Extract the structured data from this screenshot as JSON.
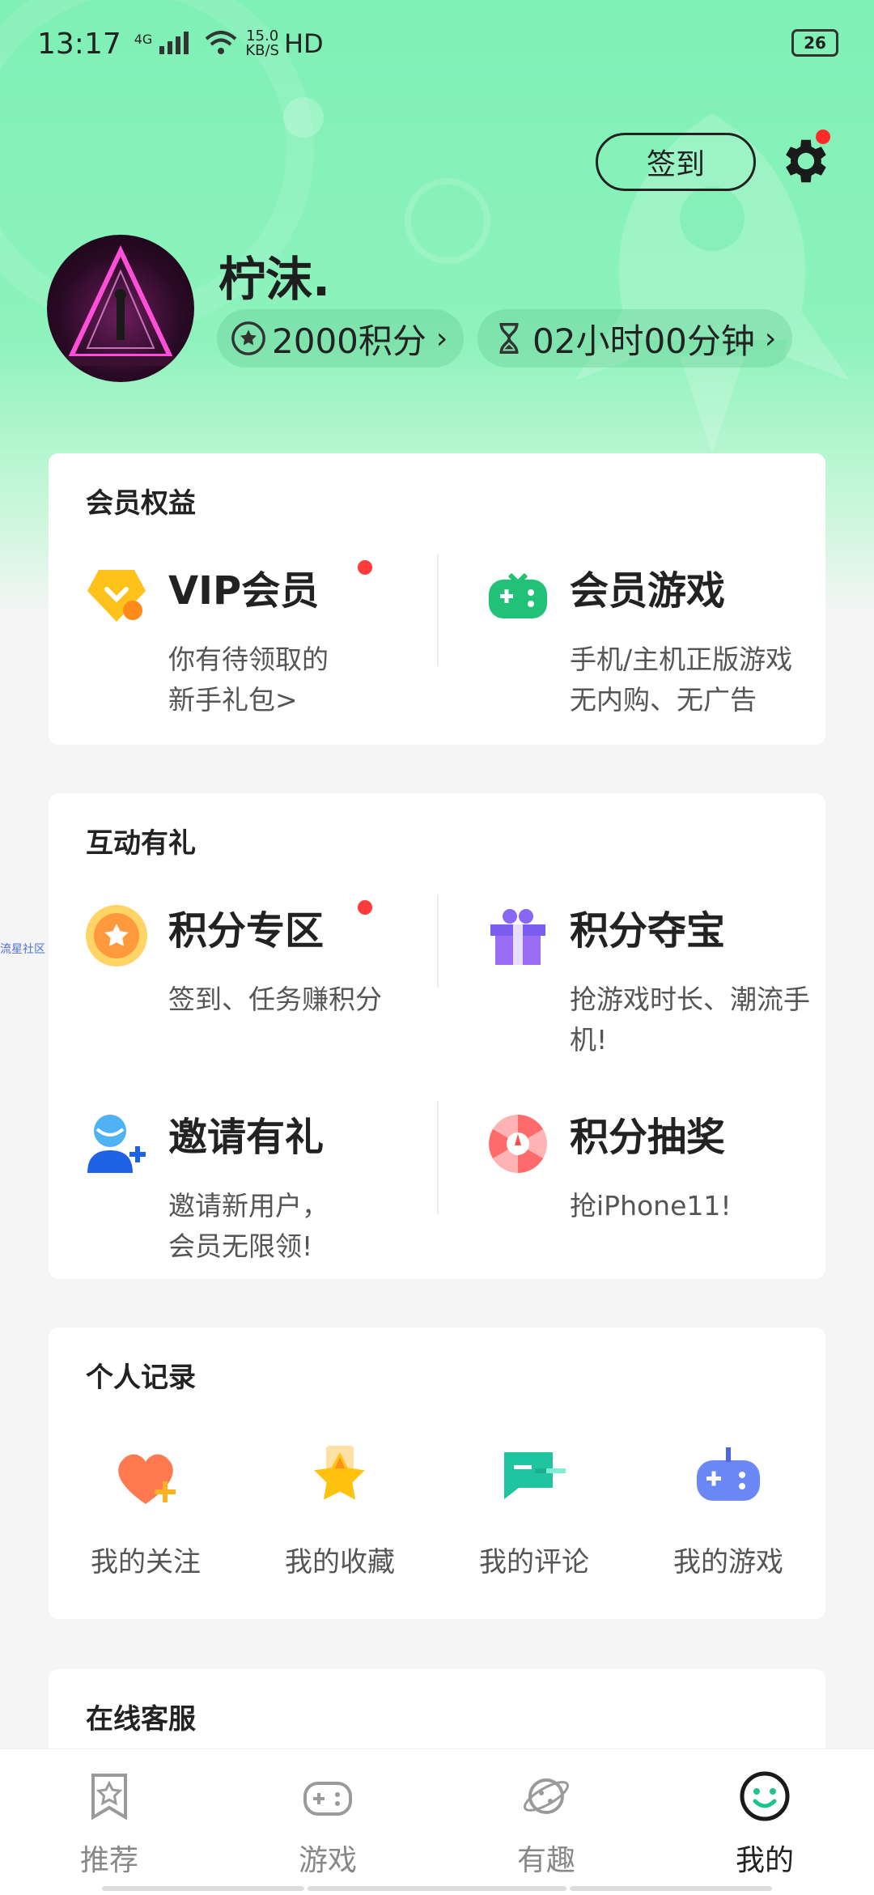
{
  "status_bar": {
    "time": "13:17",
    "signal": "4G",
    "speed_top": "15.0",
    "speed_unit": "KB/S",
    "hd": "HD",
    "battery": "26"
  },
  "header": {
    "signin_label": "签到",
    "username": "柠沫.",
    "points": "2000积分",
    "time_left": "02小时00分钟"
  },
  "member": {
    "title": "会员权益",
    "items": [
      {
        "title": "VIP会员",
        "desc": "你有待领取的\n新手礼包>"
      },
      {
        "title": "会员游戏",
        "desc": "手机/主机正版游戏\n无内购、无广告"
      }
    ]
  },
  "interact": {
    "title": "互动有礼",
    "items": [
      {
        "title": "积分专区",
        "desc": "签到、任务赚积分"
      },
      {
        "title": "积分夺宝",
        "desc": "抢游戏时长、潮流手\n机!"
      },
      {
        "title": "邀请有礼",
        "desc": "邀请新用户，\n会员无限领!"
      },
      {
        "title": "积分抽奖",
        "desc": "抢iPhone11!"
      }
    ]
  },
  "records": {
    "title": "个人记录",
    "items": [
      "我的关注",
      "我的收藏",
      "我的评论",
      "我的游戏"
    ]
  },
  "service": {
    "title": "在线客服"
  },
  "side_tag": "流星社区",
  "tabs": [
    "推荐",
    "游戏",
    "有趣",
    "我的"
  ],
  "colors": {
    "accent": "#7ff0b6",
    "badge": "#ff3b3b"
  }
}
